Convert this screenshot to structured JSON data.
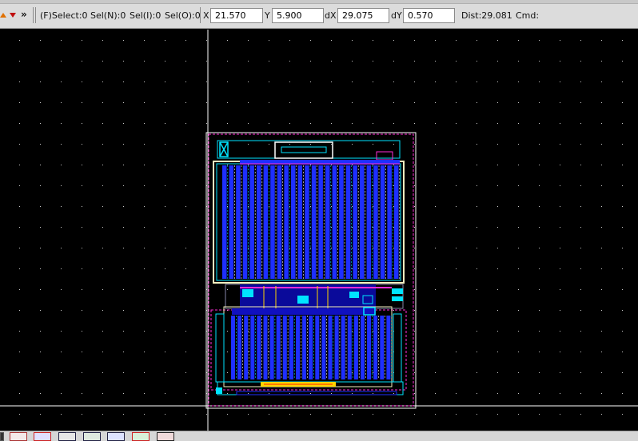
{
  "toolbar": {
    "more_glyph": "»",
    "fselect": "(F)Select:0",
    "seln": "Sel(N):0",
    "seli": "Sel(I):0",
    "selo": "Sel(O):0",
    "x_label": "X",
    "x_value": "21.570",
    "y_label": "Y",
    "y_value": "5.900",
    "dx_label": "dX",
    "dx_value": "29.075",
    "dy_label": "dY",
    "dy_value": "0.570",
    "dist": "Dist:29.081",
    "cmd": "Cmd:"
  },
  "colors": {
    "canvas_bg": "#000000",
    "metal1": "#1e2fff",
    "metal2": "#00e5ff",
    "poly": "#ff2bd6",
    "outline": "#ffffff",
    "highlight": "#ffd400"
  },
  "bottom_icons": [
    "tool-icon-1",
    "tool-icon-2",
    "tool-icon-3",
    "tool-icon-4",
    "tool-icon-5",
    "tool-icon-6",
    "tool-icon-7",
    "tool-icon-8"
  ]
}
